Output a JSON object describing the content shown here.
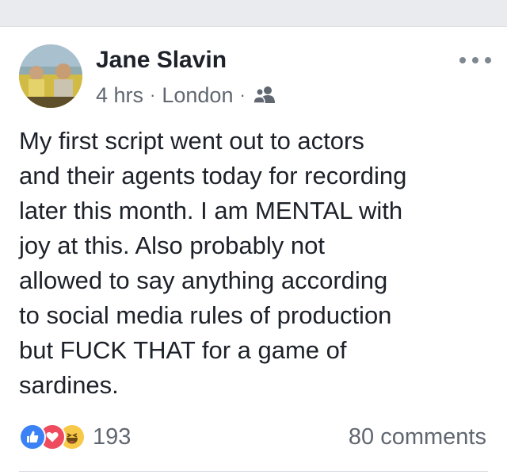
{
  "post": {
    "author": "Jane Slavin",
    "time": "4 hrs",
    "location": "London",
    "audience_icon": "friends-icon",
    "text": "My first script went out to actors\nand their agents today for recording\nlater this month. I am MENTAL with\njoy at this. Also probably not\nallowed to say anything according\nto social media rules of production\nbut FUCK THAT for a game of\nsardines.",
    "reactions": {
      "icons": [
        "like-icon",
        "love-icon",
        "haha-icon"
      ],
      "count": "193"
    },
    "comments": "80 comments"
  },
  "colors": {
    "text": "#1d2129",
    "secondary": "#606770",
    "like": "#3b82f6",
    "love": "#ef4b5f",
    "haha": "#f7c948"
  }
}
